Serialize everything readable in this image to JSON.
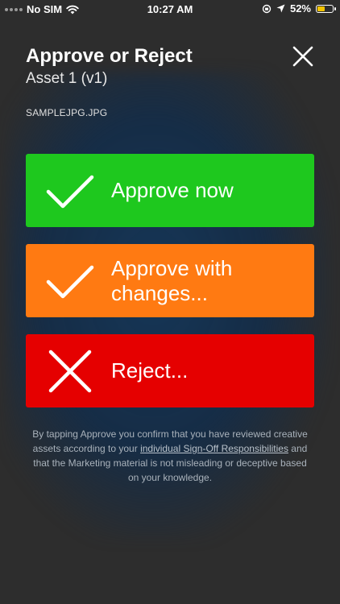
{
  "status_bar": {
    "carrier": "No SIM",
    "time": "10:27 AM",
    "battery_percent": "52%",
    "battery_level": 0.52
  },
  "dialog": {
    "title": "Approve or Reject",
    "subtitle": "Asset 1 (v1)",
    "filename": "SAMPLEJPG.JPG"
  },
  "actions": {
    "approve_label": "Approve now",
    "approve_with_changes_label": "Approve with changes...",
    "reject_label": "Reject..."
  },
  "disclaimer": {
    "text_before": "By tapping Approve you confirm that you have reviewed creative assets according to your",
    "link_text": "individual Sign-Off Responsibilities",
    "text_after": "and that the Marketing material is not misleading or deceptive based on your knowledge."
  },
  "colors": {
    "approve": "#1ec81e",
    "approve_with_changes": "#ff7a12",
    "reject": "#e50000",
    "background": "#2d2d2d"
  },
  "icons": {
    "close": "close-icon",
    "approve": "checkmark-icon",
    "reject": "x-icon"
  }
}
